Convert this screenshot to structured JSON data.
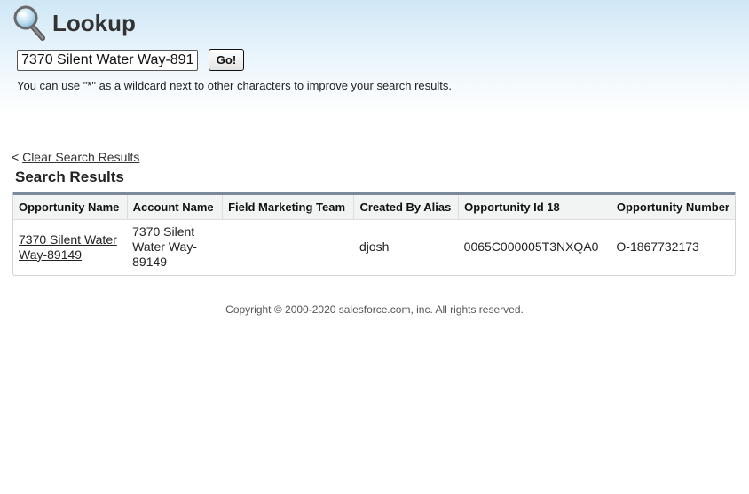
{
  "header": {
    "title": "Lookup",
    "icon": "magnifying-glass-icon"
  },
  "search": {
    "value": "7370 Silent Water Way-89149",
    "go_label": "Go!",
    "hint": "You can use \"*\" as a wildcard next to other characters to improve your search results."
  },
  "results": {
    "clear_prefix": "<",
    "clear_label": "Clear Search Results",
    "title": "Search Results",
    "columns": [
      "Opportunity Name",
      "Account Name",
      "Field Marketing Team",
      "Created By Alias",
      "Opportunity Id 18",
      "Opportunity Number"
    ],
    "rows": [
      {
        "opportunity_name": "7370 Silent Water Way-89149",
        "account_name": "7370 Silent Water Way-89149",
        "field_marketing_team": "",
        "created_by_alias": "djosh",
        "opportunity_id_18": "0065C000005T3NXQA0",
        "opportunity_number": "O-1867732173"
      }
    ]
  },
  "footer": {
    "copyright": "Copyright © 2000-2020 salesforce.com, inc. All rights reserved."
  },
  "colors": {
    "header_gradient_top": "#cfe7f6",
    "table_top_border": "#7b8a9a",
    "table_header_bg": "#f2f3f3"
  }
}
